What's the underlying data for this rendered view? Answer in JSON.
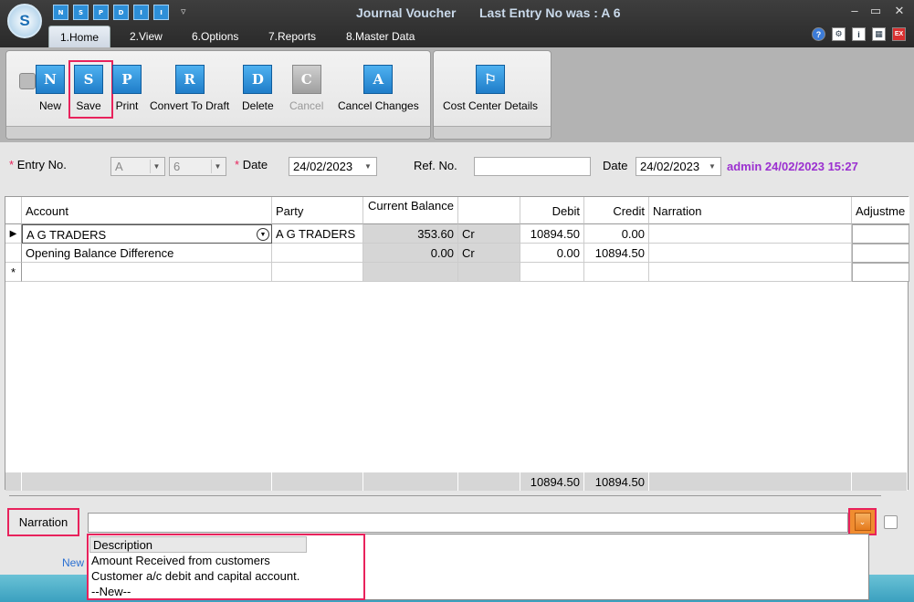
{
  "window": {
    "title": "Journal Voucher",
    "last_entry": "Last Entry No was : A 6",
    "logo_text": "S"
  },
  "quick_access": [
    "N",
    "S",
    "P",
    "D",
    "I",
    "I"
  ],
  "tabs": [
    {
      "label": "1.Home"
    },
    {
      "label": "2.View"
    },
    {
      "label": "6.Options"
    },
    {
      "label": "7.Reports"
    },
    {
      "label": "8.Master Data"
    }
  ],
  "ribbon": {
    "new_label": "New",
    "new_icon": "N",
    "save_label": "Save",
    "save_icon": "S",
    "print_label": "Print",
    "print_icon": "P",
    "convert_label": "Convert To Draft",
    "convert_icon": "R",
    "delete_label": "Delete",
    "delete_icon": "D",
    "cancel_label": "Cancel",
    "cancel_icon": "C",
    "cancel_changes_label": "Cancel Changes",
    "cancel_changes_icon": "A",
    "cost_center_label": "Cost Center Details"
  },
  "form": {
    "entry_no_label": "Entry No.",
    "entry_series": "A",
    "entry_number": "6",
    "date_label": "Date",
    "date_value": "24/02/2023",
    "ref_no_label": "Ref. No.",
    "ref_no_value": "",
    "date2_label": "Date",
    "date2_value": "24/02/2023",
    "user_info": "admin 24/02/2023 15:27"
  },
  "grid": {
    "columns": [
      "Account",
      "Party",
      "Current Balance",
      "Debit",
      "Credit",
      "Narration",
      "Adjustme"
    ],
    "rows": [
      {
        "account": "A G TRADERS",
        "party": "A G TRADERS",
        "balance": "353.60",
        "drcr": "Cr",
        "debit": "10894.50",
        "credit": "0.00",
        "narration": ""
      },
      {
        "account": "Opening Balance Difference",
        "party": "",
        "balance": "0.00",
        "drcr": "Cr",
        "debit": "0.00",
        "credit": "10894.50",
        "narration": ""
      }
    ],
    "totals": {
      "debit": "10894.50",
      "credit": "10894.50"
    }
  },
  "narration": {
    "label": "Narration",
    "value": ""
  },
  "dropdown": {
    "header": "Description",
    "items": [
      "Amount Received from customers",
      "Customer a/c debit and capital account.",
      "--New--"
    ]
  },
  "status": {
    "new_label": "New"
  }
}
